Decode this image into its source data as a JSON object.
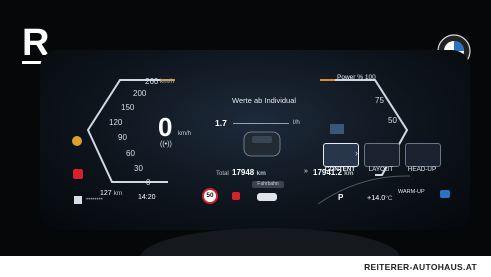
{
  "brand": {
    "logo_letter": "R",
    "footer_site": "REITERER-AUTOHAUS.AT"
  },
  "speedo": {
    "ticks": [
      "260",
      "200",
      "150",
      "120",
      "90",
      "60",
      "30",
      "0"
    ],
    "max_unit": "km/h",
    "current_speed": "0",
    "speed_unit": "km/h"
  },
  "center": {
    "title": "Werte ab Individual",
    "consumption_value": "1.7",
    "consumption_unit": "l/h",
    "total_label": "Total",
    "total_value": "17948",
    "total_unit": "km",
    "trip_value": "17941.2",
    "trip_unit": "km",
    "road_label": "Fahrbahn"
  },
  "power": {
    "label": "Power",
    "unit": "%",
    "max": "100",
    "ticks": [
      "75",
      "50"
    ]
  },
  "menu": {
    "items": [
      {
        "label": "CONTENT",
        "active": true
      },
      {
        "label": "LAYOUT",
        "active": false
      },
      {
        "label": "HEAD-UP",
        "active": false
      }
    ]
  },
  "status": {
    "range_value": "127",
    "range_unit": "km",
    "time": "14:20",
    "speed_limit": "50",
    "gear": "P",
    "temperature": "+14.0",
    "temperature_unit": "°C",
    "warm_up": "WARM-UP"
  },
  "colors": {
    "accent_orange": "#e0892a",
    "bezel_blue": "#1d2a3a",
    "warning_red": "#d8202a",
    "gauge_green": "#5fc84a"
  },
  "icons": [
    "traction-warning-icon",
    "airbag-warning-icon",
    "battery-icon",
    "fuel-icon",
    "seatbelt-icon",
    "car-icon",
    "bmw-logo-icon",
    "energy-icon"
  ]
}
